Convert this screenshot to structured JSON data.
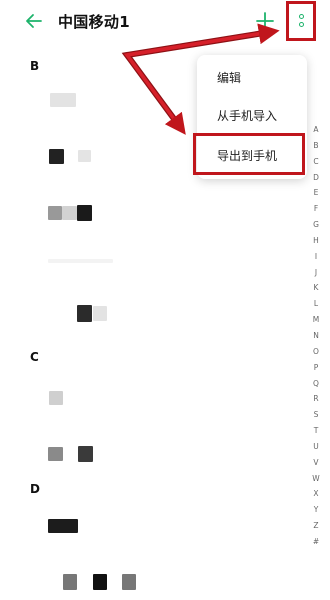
{
  "header": {
    "title": "中国移动1",
    "accent_color": "#1db36b",
    "icons": [
      "back-arrow-icon",
      "plus-icon",
      "more-vertical-icon"
    ]
  },
  "menu": {
    "items": [
      {
        "label": "编辑"
      },
      {
        "label": "从手机导入"
      },
      {
        "label": "导出到手机"
      }
    ]
  },
  "sections": [
    "B",
    "C",
    "D"
  ],
  "alphabet": [
    "A",
    "B",
    "C",
    "D",
    "E",
    "F",
    "G",
    "H",
    "I",
    "J",
    "K",
    "L",
    "M",
    "N",
    "O",
    "P",
    "Q",
    "R",
    "S",
    "T",
    "U",
    "V",
    "W",
    "X",
    "Y",
    "Z",
    "#"
  ],
  "annotation_color": "#c0161c"
}
